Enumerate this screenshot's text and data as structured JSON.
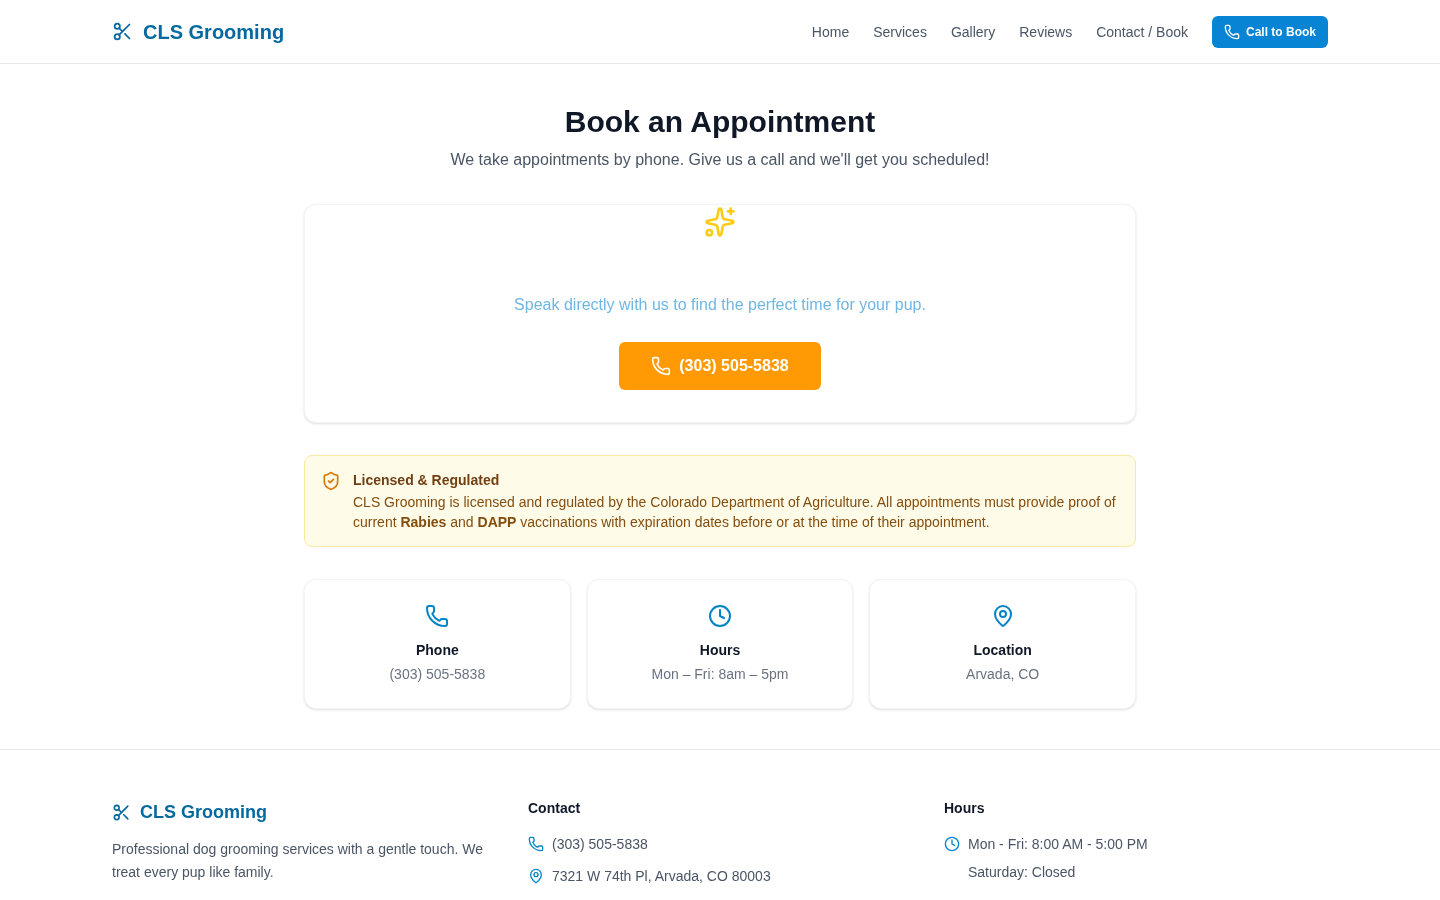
{
  "header": {
    "logo": {
      "text": "CLS Grooming"
    },
    "nav": [
      {
        "label": "Home"
      },
      {
        "label": "Services"
      },
      {
        "label": "Gallery"
      },
      {
        "label": "Reviews"
      },
      {
        "label": "Contact / Book"
      }
    ],
    "cta": {
      "label": "Call to Book"
    }
  },
  "hero": {
    "title": "Book an Appointment",
    "subtitle": "We take appointments by phone. Give us a call and we'll get you scheduled!"
  },
  "booking_card": {
    "tagline": "Speak directly with us to find the perfect time for your pup.",
    "phone_button": {
      "label": "(303) 505-5838"
    }
  },
  "notice": {
    "title": "Licensed & Regulated",
    "text": "CLS Grooming is licensed and regulated by the Colorado Department of Agriculture. All appointments must provide proof of current **Rabies** and **DAPP** vaccinations with expiration dates before or at the time of their appointment."
  },
  "info_cards": [
    {
      "kind": "phone",
      "title": "Phone",
      "value": "(303) 505-5838"
    },
    {
      "kind": "hours",
      "title": "Hours",
      "value": "Mon – Fri: 8am – 5pm"
    },
    {
      "kind": "location",
      "title": "Location",
      "value": "Arvada, CO"
    }
  ],
  "footer": {
    "brand": {
      "name": "CLS Grooming",
      "description": "Professional dog grooming services with a gentle touch. We treat every pup like family."
    },
    "contact": {
      "heading": "Contact",
      "items": [
        {
          "kind": "phone",
          "text": "(303) 505-5838"
        },
        {
          "kind": "location",
          "text": "7321 W 74th Pl, Arvada, CO 80003"
        }
      ]
    },
    "hours": {
      "heading": "Hours",
      "lines": [
        {
          "kind": "clock",
          "text": "Mon - Fri: 8:00 AM - 5:00 PM"
        },
        {
          "kind": "plain",
          "text": "Saturday: Closed"
        }
      ]
    }
  }
}
